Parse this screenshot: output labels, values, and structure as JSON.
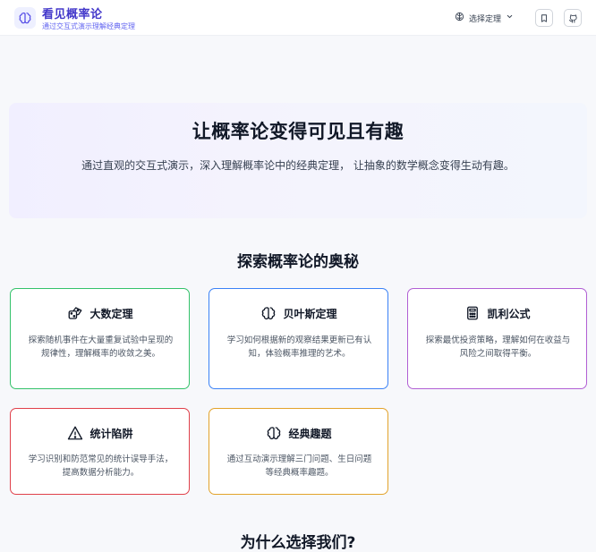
{
  "header": {
    "title": "看见概率论",
    "subtitle": "通过交互式演示理解经典定理",
    "theme_select_label": "选择定理",
    "logo_icon": "brain-icon",
    "bookmark_icon": "bookmark-icon",
    "github_icon": "github-icon"
  },
  "hero": {
    "title": "让概率论变得可见且有趣",
    "subtitle": "通过直观的交互式演示，深入理解概率论中的经典定理， 让抽象的数学概念变得生动有趣。"
  },
  "features": {
    "title": "探索概率论的奥秘",
    "cards": [
      {
        "title": "大数定理",
        "icon": "dice-icon",
        "color": "#34c26a",
        "desc": "探索随机事件在大量重复试验中呈现的规律性，理解概率的收敛之美。"
      },
      {
        "title": "贝叶斯定理",
        "icon": "brain-icon",
        "color": "#3b82f6",
        "desc": "学习如何根据新的观察结果更新已有认知，体验概率推理的艺术。"
      },
      {
        "title": "凯利公式",
        "icon": "calculator-icon",
        "color": "#b15fd4",
        "desc": "探索最优投资策略，理解如何在收益与风险之间取得平衡。"
      },
      {
        "title": "统计陷阱",
        "icon": "warning-icon",
        "color": "#e0404a",
        "desc": "学习识别和防范常见的统计误导手法，提高数据分析能力。"
      },
      {
        "title": "经典趣题",
        "icon": "brain-icon",
        "color": "#e3a32b",
        "desc": "通过互动演示理解三门问题、生日问题等经典概率趣题。"
      }
    ]
  },
  "why": {
    "title": "为什么选择我们?"
  }
}
